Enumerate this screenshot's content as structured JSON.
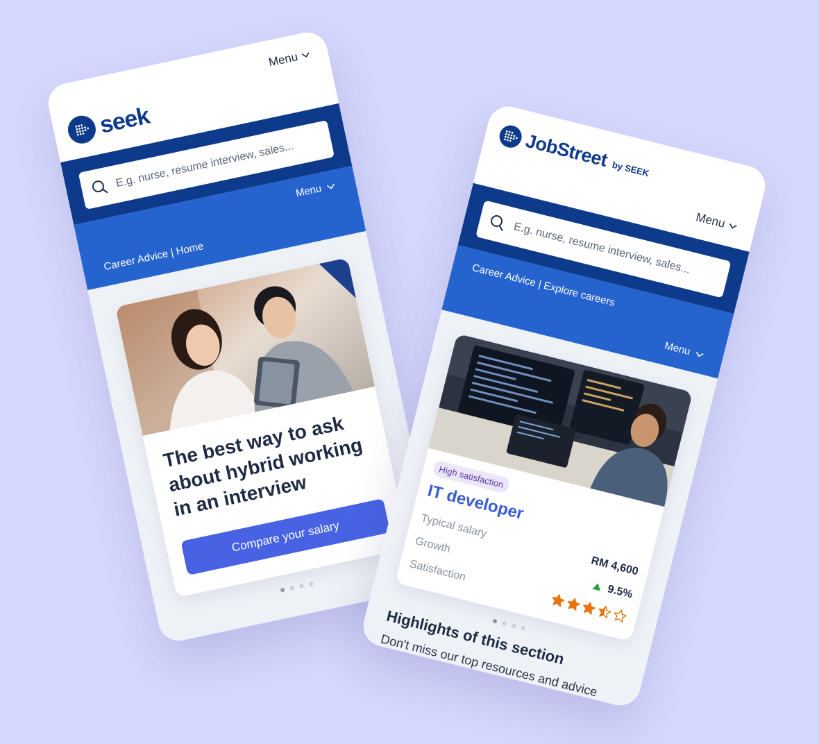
{
  "seek": {
    "logo_text": "seek",
    "menu_label": "Menu",
    "search_placeholder": "E.g. nurse, resume interview, sales...",
    "band_menu_label": "Menu",
    "breadcrumb": "Career Advice | Home",
    "card_title": "The best way to ask about hybrid working in an interview",
    "cta_label": "Compare your salary",
    "carousel_pages": 4,
    "carousel_active": 1
  },
  "jobstreet": {
    "logo_text": "JobStreet",
    "logo_sub": "by SEEK",
    "menu_label": "Menu",
    "search_placeholder": "E.g. nurse, resume interview, sales...",
    "breadcrumb": "Career Advice | Explore careers",
    "band_menu_label": "Menu",
    "badge": "High satisfaction",
    "job_title": "IT developer",
    "stats": {
      "salary_label": "Typical salary",
      "salary_value": "RM 4,600",
      "growth_label": "Growth",
      "growth_value": "9.5%",
      "satisfaction_label": "Satisfaction",
      "rating": 3.5,
      "rating_max": 5
    },
    "carousel_pages": 4,
    "carousel_active": 1,
    "highlights_title": "Highlights of this section",
    "highlights_sub": "Don't miss our top resources and advice for your next career"
  },
  "colors": {
    "background": "#d6d7fc",
    "brand_navy": "#0d3a8a",
    "brand_blue": "#2563cf",
    "cta": "#4763e4",
    "job_title": "#3b5bd8",
    "star": "#e8740c",
    "growth_up": "#2e9e3e"
  }
}
